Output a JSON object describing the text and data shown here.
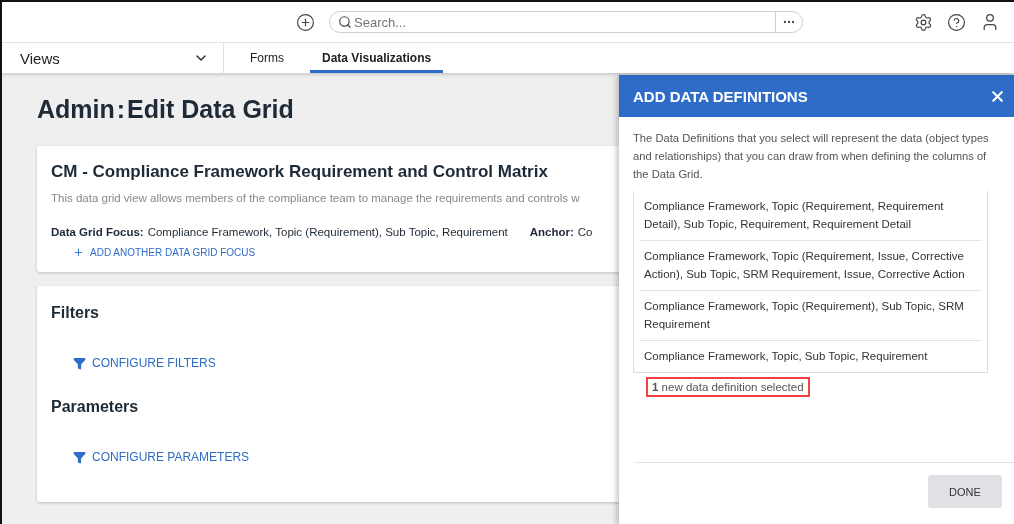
{
  "topbar": {
    "search": {
      "placeholder": "Search..."
    }
  },
  "nav": {
    "views": "Views",
    "tabs": [
      {
        "label": "Forms",
        "selected": false
      },
      {
        "label": "Data Visualizations",
        "selected": true
      }
    ]
  },
  "page": {
    "title_prefix": "Admin",
    "title_separator": ":",
    "title": "Edit Data Grid",
    "grid_card": {
      "name": "CM - Compliance Framework Requirement and Control Matrix",
      "description": "This data grid view allows members of the compliance team to manage the requirements and controls w",
      "focus_label": "Data Grid Focus:",
      "focus_value": "Compliance Framework, Topic (Requirement), Sub Topic, Requirement",
      "anchor_label": "Anchor:",
      "anchor_value": "Co",
      "add_focus": "ADD ANOTHER DATA GRID FOCUS"
    },
    "sections": [
      {
        "title": "Filters",
        "action": "CONFIGURE FILTERS"
      },
      {
        "title": "Parameters",
        "action": "CONFIGURE PARAMETERS"
      }
    ]
  },
  "panel": {
    "title": "ADD DATA DEFINITIONS",
    "intro": "The Data Definitions that you select will represent the data (object types and relationships) that you can draw from when defining the columns of the Data Grid.",
    "definitions": [
      "Compliance Framework, Topic (Requirement, Requirement Detail), Sub Topic, Requirement, Requirement Detail",
      "Compliance Framework, Topic (Requirement, Issue, Corrective Action), Sub Topic, SRM Requirement, Issue, Corrective Action",
      "Compliance Framework, Topic (Requirement), Sub Topic, SRM Requirement",
      "Compliance Framework, Topic, Sub Topic, Requirement"
    ],
    "status": {
      "text": "**1** new data definition selected",
      "highlighted": true
    },
    "done": "DONE"
  }
}
